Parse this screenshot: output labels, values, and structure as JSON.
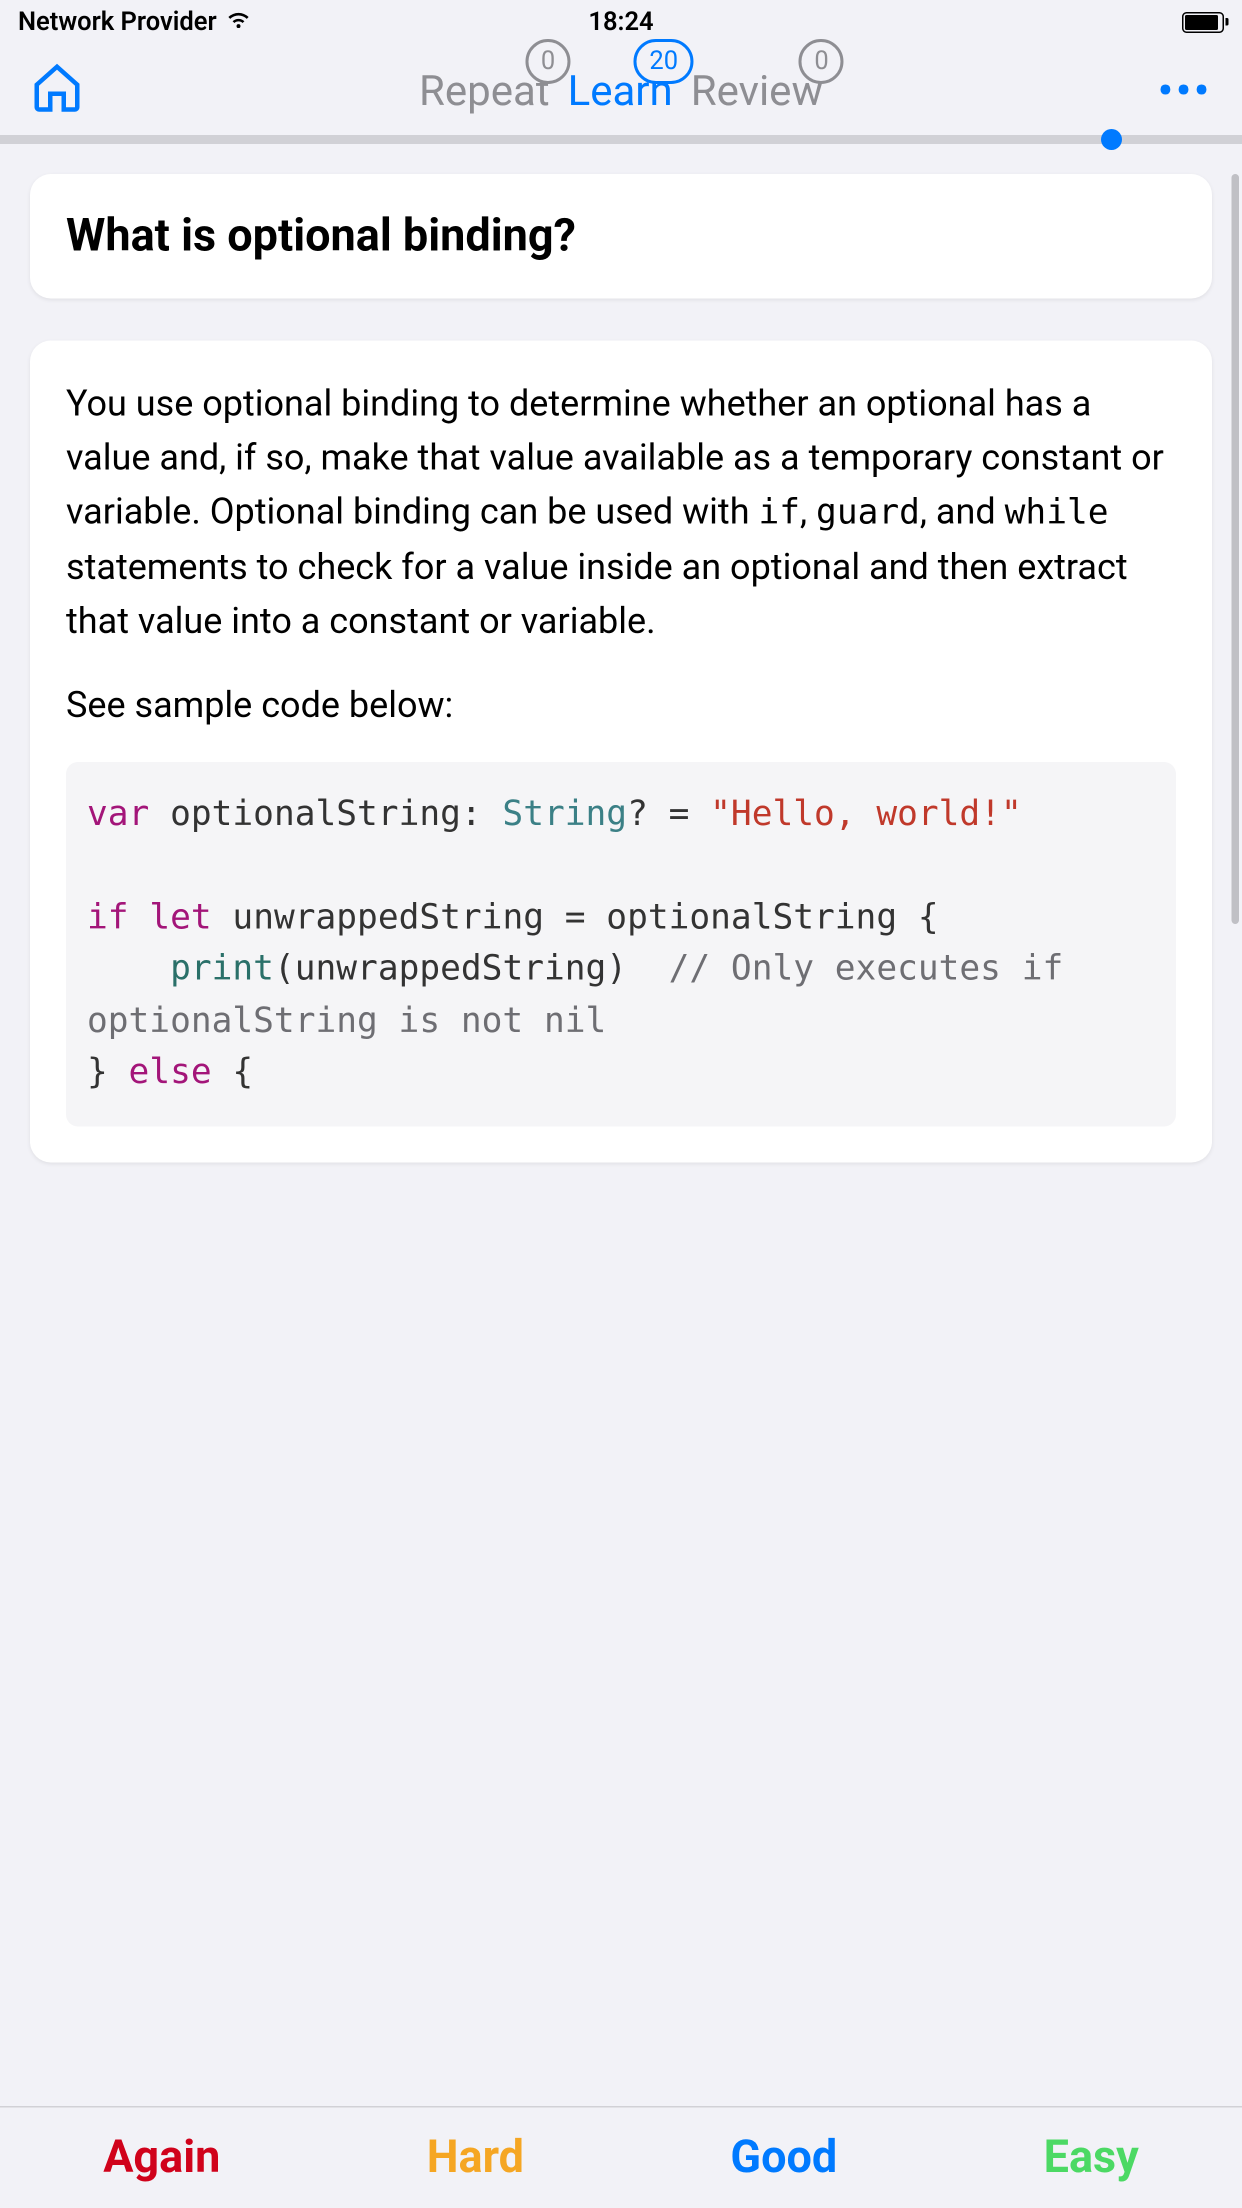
{
  "status": {
    "provider": "Network Provider",
    "time": "18:24"
  },
  "nav": {
    "tabs": {
      "repeat": {
        "label": "Repeat",
        "count": "0"
      },
      "learn": {
        "label": "Learn",
        "count": "20"
      },
      "review": {
        "label": "Review",
        "count": "0"
      }
    }
  },
  "card": {
    "question": "What is optional binding?",
    "answer": {
      "p1_a": "You use optional binding to determine whether an optional has a value and, if so, make that value available as a temporary constant or variable. Optional binding can be used with ",
      "kw_if": "if",
      "p1_b": ", ",
      "kw_guard": "guard",
      "p1_c": ", and ",
      "kw_while": "while",
      "p1_d": " statements to check for a value inside an optional and then extract that value into a constant or variable.",
      "p2": "See sample code below:"
    },
    "code": {
      "var": "var",
      "decl1": " optionalString: ",
      "type": "String",
      "decl2": "? = ",
      "str": "\"Hello, world!\"",
      "if": "if",
      "let": "let",
      "cond": " unwrappedString = optionalString {",
      "print": "print",
      "call": "(unwrappedString)  ",
      "cmt": "// Only executes if optionalString is not nil",
      "else_close": "} ",
      "else": "else",
      "else_open": " {"
    }
  },
  "ratings": {
    "again": "Again",
    "hard": "Hard",
    "good": "Good",
    "easy": "Easy"
  }
}
